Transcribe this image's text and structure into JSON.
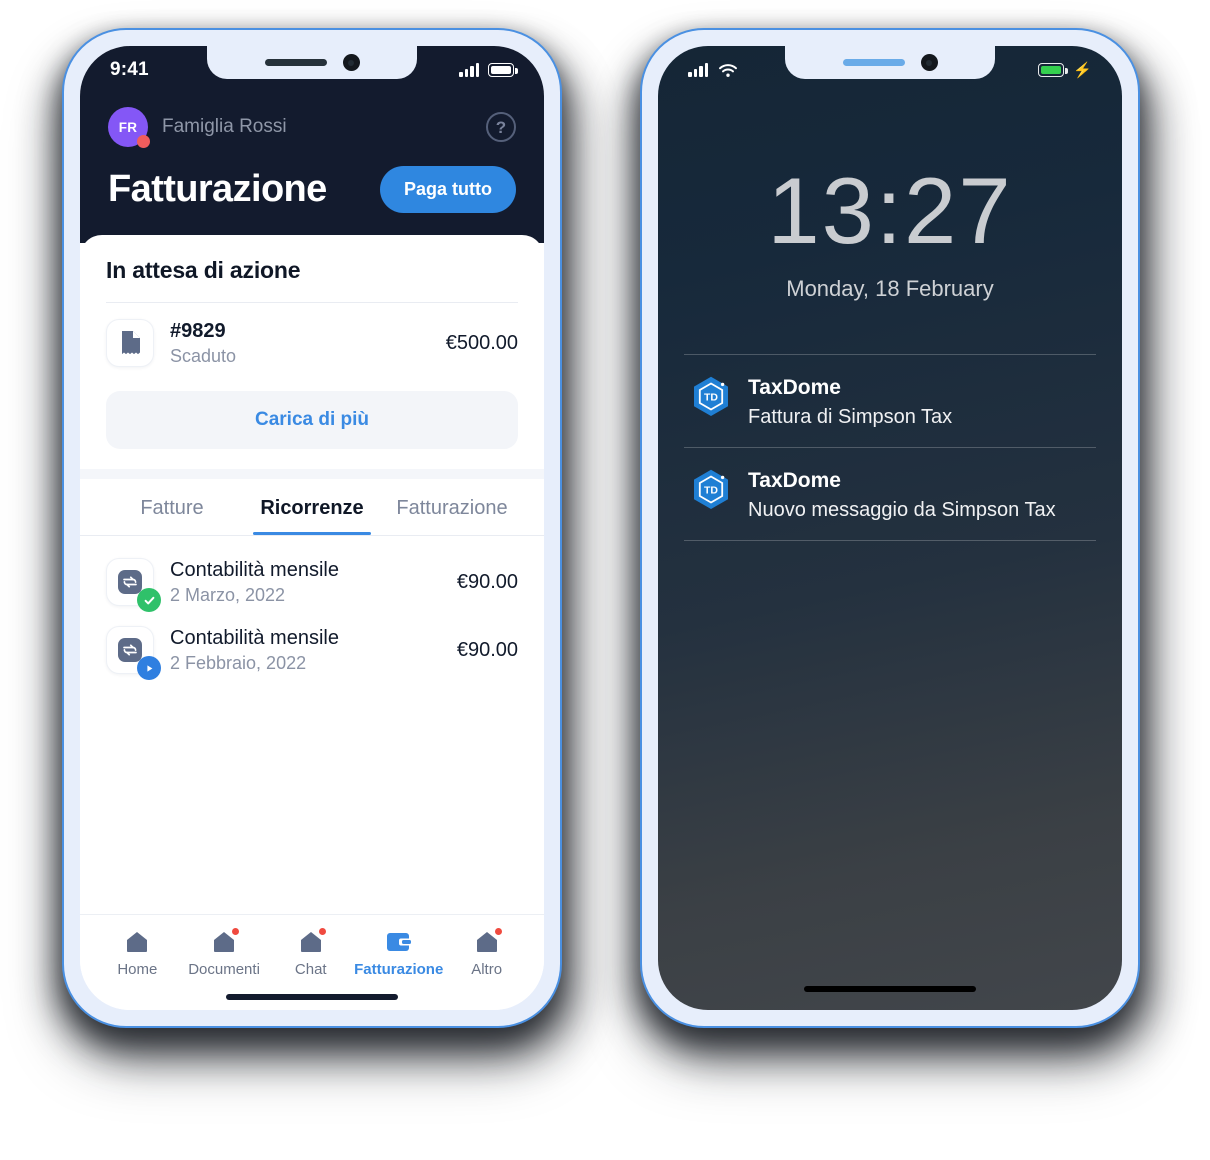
{
  "left_phone": {
    "status_bar": {
      "time": "9:41",
      "signal_icon": "signal-bars-icon",
      "battery_icon": "battery-icon"
    },
    "header": {
      "avatar_initials": "FR",
      "org_name": "Famiglia Rossi",
      "help_icon": "help-circle-icon",
      "page_title": "Fatturazione",
      "pay_all_label": "Paga tutto"
    },
    "pending_section": {
      "title": "In attesa di azione",
      "invoice": {
        "icon": "invoice-document-icon",
        "number": "#9829",
        "status": "Scaduto",
        "amount": "€500.00"
      },
      "load_more_label": "Carica di più"
    },
    "tabs": [
      {
        "label": "Fatture",
        "active": false
      },
      {
        "label": "Ricorrenze",
        "active": true
      },
      {
        "label": "Fatturazione",
        "active": false
      }
    ],
    "recurring_items": [
      {
        "icon": "recurring-arrows-icon",
        "badge": "check-badge",
        "name": "Contabilità mensile",
        "date": "2 Marzo, 2022",
        "amount": "€90.00"
      },
      {
        "icon": "recurring-arrows-icon",
        "badge": "play-badge",
        "name": "Contabilità mensile",
        "date": "2 Febbraio, 2022",
        "amount": "€90.00"
      }
    ],
    "bottom_nav": [
      {
        "label": "Home",
        "icon": "home-icon",
        "dot": false,
        "active": false
      },
      {
        "label": "Documenti",
        "icon": "documents-icon",
        "dot": true,
        "active": false
      },
      {
        "label": "Chat",
        "icon": "chat-icon",
        "dot": true,
        "active": false
      },
      {
        "label": "Fatturazione",
        "icon": "wallet-icon",
        "dot": false,
        "active": true
      },
      {
        "label": "Altro",
        "icon": "more-icon",
        "dot": true,
        "active": false
      }
    ]
  },
  "right_phone": {
    "status_bar": {
      "signal_icon": "signal-bars-icon",
      "wifi_icon": "wifi-icon",
      "battery_icon": "battery-charging-icon"
    },
    "lock_screen": {
      "time": "13:27",
      "date": "Monday, 18 February",
      "notifications": [
        {
          "app_icon": "taxdome-icon",
          "app_name": "TaxDome",
          "message": "Fattura di Simpson Tax"
        },
        {
          "app_icon": "taxdome-icon",
          "app_name": "TaxDome",
          "message": "Nuovo messaggio da Simpson Tax"
        }
      ]
    }
  },
  "colors": {
    "accent_blue": "#3a8ae3",
    "header_navy": "#131b2e",
    "avatar_purple": "#8457f6",
    "badge_red": "#ef5d5d",
    "success_green": "#2fc16a",
    "frame_light": "#e7eefb",
    "frame_outline": "#4a90e2"
  }
}
